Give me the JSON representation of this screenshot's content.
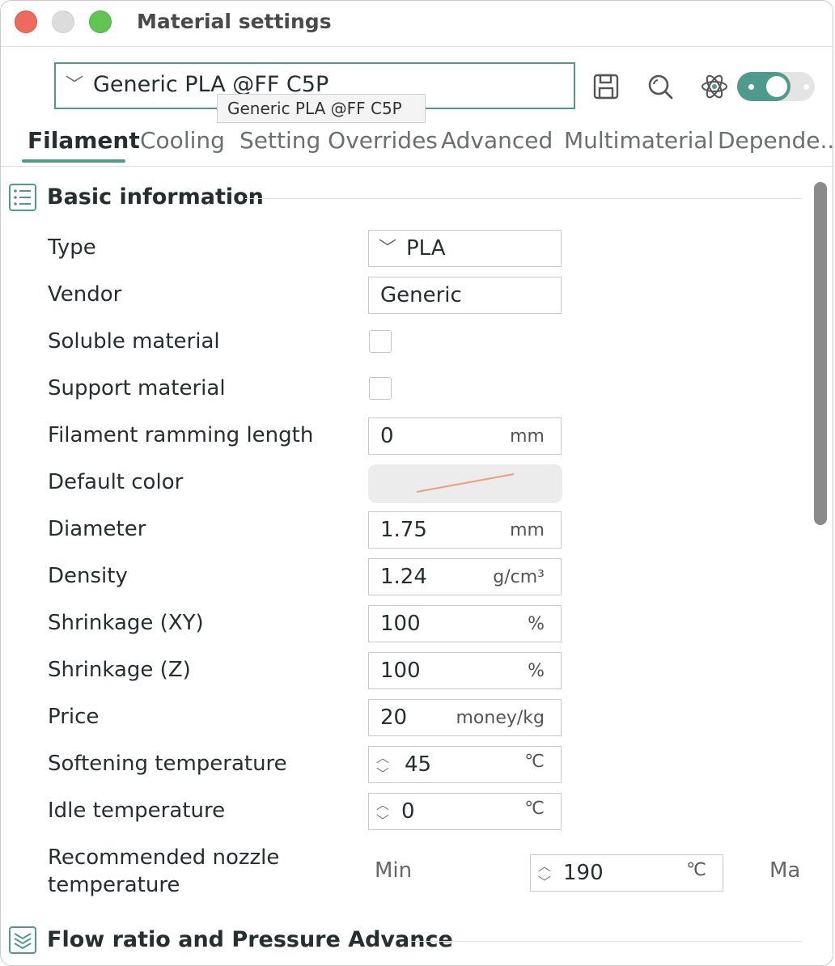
{
  "window": {
    "title": "Material settings"
  },
  "preset": {
    "value": "Generic PLA @FF C5P",
    "tooltip": "Generic PLA @FF C5P"
  },
  "toolbar": {
    "icons": [
      "save-icon",
      "search-icon",
      "atom-icon"
    ],
    "toggle_on": true
  },
  "tabs": [
    {
      "label": "Filament",
      "active": true
    },
    {
      "label": "Cooling"
    },
    {
      "label": "Setting Overrides"
    },
    {
      "label": "Advanced"
    },
    {
      "label": "Multimaterial"
    },
    {
      "label": "Depende..."
    }
  ],
  "sections": {
    "basic": {
      "title": "Basic information"
    },
    "flow": {
      "title": "Flow ratio and Pressure Advance"
    }
  },
  "fields": {
    "type": {
      "label": "Type",
      "value": "PLA"
    },
    "vendor": {
      "label": "Vendor",
      "value": "Generic"
    },
    "soluble": {
      "label": "Soluble material",
      "checked": false
    },
    "support": {
      "label": "Support material",
      "checked": false
    },
    "ramming": {
      "label": "Filament ramming length",
      "value": "0",
      "unit": "mm"
    },
    "color": {
      "label": "Default color"
    },
    "diameter": {
      "label": "Diameter",
      "value": "1.75",
      "unit": "mm"
    },
    "density": {
      "label": "Density",
      "value": "1.24",
      "unit": "g/cm³"
    },
    "shrink_xy": {
      "label": "Shrinkage (XY)",
      "value": "100",
      "unit": "%"
    },
    "shrink_z": {
      "label": "Shrinkage (Z)",
      "value": "100",
      "unit": "%"
    },
    "price": {
      "label": "Price",
      "value": "20",
      "unit": "money/kg"
    },
    "softening": {
      "label": "Softening temperature",
      "value": "45",
      "unit": "℃"
    },
    "idle": {
      "label": "Idle temperature",
      "value": "0",
      "unit": "℃"
    },
    "nozzle": {
      "label_line1": "Recommended nozzle",
      "label_line2": "temperature",
      "min_label": "Min",
      "min_value": "190",
      "unit": "℃",
      "max_label": "Ma"
    }
  },
  "colors": {
    "accent": "#4f9a8c",
    "text": "#262e30"
  }
}
